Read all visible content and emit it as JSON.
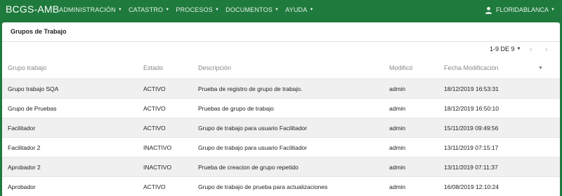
{
  "app": {
    "brand": "BCGS-AMB",
    "menu": [
      {
        "label": "ADMINISTRACIÓN"
      },
      {
        "label": "CATASTRO"
      },
      {
        "label": "PROCESOS"
      },
      {
        "label": "DOCUMENTOS"
      },
      {
        "label": "AYUDA"
      }
    ],
    "user": "FLORIDABLANCA"
  },
  "panel": {
    "title": "Grupos de Trabajo",
    "pagination": "1-9 DE 9"
  },
  "table": {
    "headers": [
      "Grupo trabajo",
      "Estado",
      "Descripción",
      "Modificó",
      "Fecha Modificación"
    ],
    "rows": [
      [
        "Grupo trabajo SQA",
        "ACTIVO",
        "Prueba de registro de grupo de trabajo.",
        "admin",
        "18/12/2019 16:53:31"
      ],
      [
        "Grupo de Pruebas",
        "ACTIVO",
        "Pruebas de grupo de trabajo",
        "admin",
        "18/12/2019 16:50:10"
      ],
      [
        "Facilitador",
        "ACTIVO",
        "Grupo de trabajo para usuario Facilitador",
        "admin",
        "15/11/2019 09:49:56"
      ],
      [
        "Facilitador 2",
        "INACTIVO",
        "Grupo de trabajo para usuario Facilitador",
        "admin",
        "13/11/2019 07:15:17"
      ],
      [
        "Aprobador 2",
        "INACTIVO",
        "Prueba de creacion de grupo repetido",
        "admin",
        "13/11/2019 07:11:37"
      ],
      [
        "Aprobador",
        "ACTIVO",
        "Grupo de trabajo de prueba para actualizaciones",
        "admin",
        "16/08/2019 12:10:24"
      ]
    ]
  },
  "icons": {
    "menu_caret": "caret-down-icon",
    "user": "user-icon",
    "pagination_menu": "caret-down-icon",
    "prev": "chevron-left-icon",
    "next": "chevron-right-icon",
    "sort": "caret-down-icon"
  },
  "colors": {
    "navbar": "#1f7a3d",
    "row_stripe": "#f0f0f0",
    "header_text": "#8a8a8a"
  }
}
